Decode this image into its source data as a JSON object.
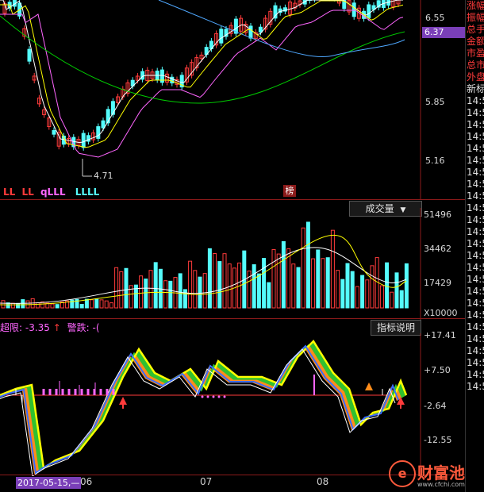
{
  "price_axis": {
    "labels": [
      "6.55",
      "5.85",
      "5.16"
    ],
    "current_price": "6.37",
    "low_marker": "4.71"
  },
  "price_legend": [
    "LL",
    "LL",
    "qLLL",
    "LLLL"
  ],
  "badge": "榜",
  "volume": {
    "button": "成交量",
    "labels": [
      "51496",
      "34462",
      "17429"
    ],
    "unit": "X10000"
  },
  "indicator": {
    "legend_a": "超限: -3.35",
    "legend_b": "警跌: -(",
    "button": "指标说明",
    "labels": [
      "+17.41",
      "+7.50",
      "-2.64",
      "-12.55"
    ]
  },
  "time_axis": {
    "date_cursor": "2017-05-15,—",
    "months": [
      "06",
      "07",
      "08"
    ]
  },
  "right_panel": {
    "items": [
      "涨幅",
      "振幅",
      "总手",
      "金额",
      "市盈",
      "总市",
      "外盘",
      "新标",
      "14:5",
      "14:5",
      "14:5",
      "14:5",
      "14:5",
      "14:5",
      "14:5",
      "14:5",
      "14:5",
      "14:5",
      "14:5",
      "14:5",
      "14:5",
      "14:5",
      "14:5",
      "14:5",
      "14:5",
      "14:5",
      "14:5",
      "14:5",
      "14:5",
      "14:5",
      "14:5",
      "14:5",
      "14:5"
    ]
  },
  "watermark": {
    "logo_text": "财富池",
    "url": "www.cfchi.com"
  },
  "colors": {
    "up": "#ff3b3b",
    "down": "#54fcfc",
    "ma5": "#ffffff",
    "ma10": "#ffff00",
    "ma20": "#ff66ff",
    "ma30": "#00cc00",
    "ma60": "#4fa8ff",
    "current_price_bg": "#7a3fb8",
    "logo": "#ff5a3c"
  }
}
